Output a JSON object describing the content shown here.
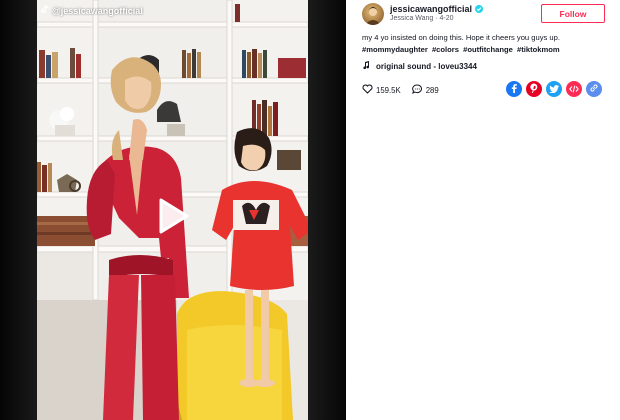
{
  "video": {
    "watermark": "@jessicawangofficial",
    "play_button": "play-icon"
  },
  "author": {
    "username": "jessicawangofficial",
    "display_name": "Jessica Wang",
    "date": "4-20",
    "meta": "Jessica Wang · 4-20",
    "verified": true
  },
  "follow_label": "Follow",
  "caption": "my 4 yo insisted on doing this. Hope it cheers you guys up.",
  "hashtags": [
    "#mommydaughter",
    "#colors",
    "#outfitchange",
    "#tiktokmom"
  ],
  "sound": "original sound - loveu3344",
  "stats": {
    "likes": "159.5K",
    "comments": "289"
  },
  "share_icons": [
    "facebook-icon",
    "pinterest-icon",
    "twitter-icon",
    "embed-icon",
    "link-icon"
  ],
  "colors": {
    "accent": "#fe2c55",
    "verified": "#20d5ec",
    "facebook": "#1877f2",
    "pinterest": "#e60023",
    "twitter": "#1da1f2",
    "embed": "#fe2c55",
    "link": "#5b8def"
  }
}
